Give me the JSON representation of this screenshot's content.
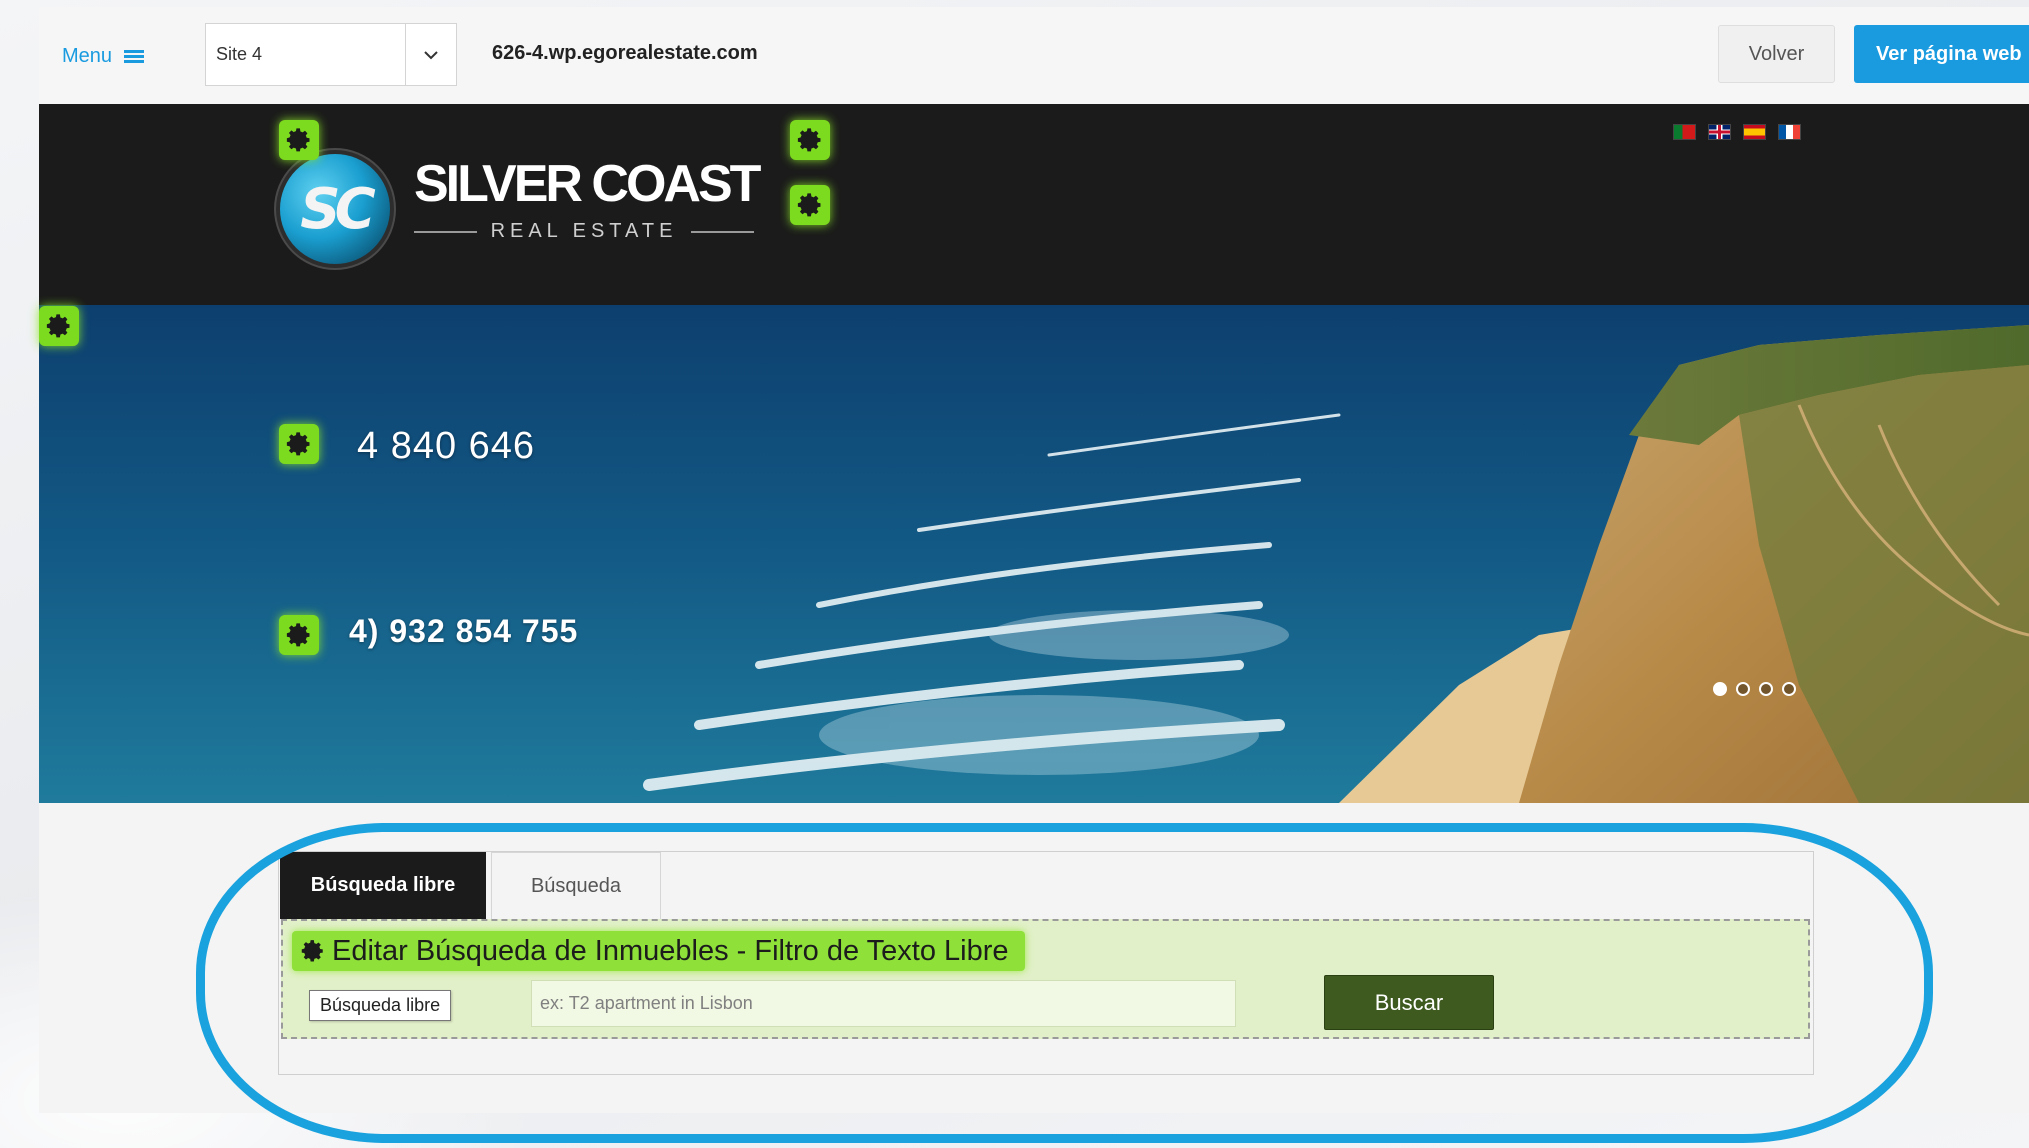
{
  "topbar": {
    "menu_label": "Menu",
    "site_select_value": "Site 4",
    "domain": "626-4.wp.egorealestate.com",
    "back_label": "Volver",
    "view_site_label": "Ver página web"
  },
  "header": {
    "logo_initials": "SC",
    "logo_title": "SILVER COAST",
    "logo_subtitle": "REAL ESTATE",
    "languages": [
      "pt",
      "gb",
      "es",
      "fr"
    ]
  },
  "hero": {
    "phone_1": "4 840 646",
    "phone_2": "4) 932 854 755",
    "slides": 4,
    "active_slide": 1
  },
  "search": {
    "tabs": [
      {
        "label": "Búsqueda libre",
        "active": true
      },
      {
        "label": "Búsqueda",
        "active": false
      }
    ],
    "edit_label": "Editar Búsqueda de Inmuebles - Filtro de Texto Libre",
    "field_label": "Búsqueda libre",
    "input_value": "",
    "input_placeholder": "ex: T2 apartment in Lisbon",
    "submit_label": "Buscar"
  },
  "colors": {
    "accent_blue": "#1a9be0",
    "gear_green": "#7ddb1f",
    "edit_zone": "#e2f0c9",
    "buscar_green": "#3e5a1f",
    "highlight_ring": "#1aa2de"
  },
  "icons": [
    "hamburger-icon",
    "chevron-down-icon",
    "gear-icon",
    "flag-icon"
  ]
}
